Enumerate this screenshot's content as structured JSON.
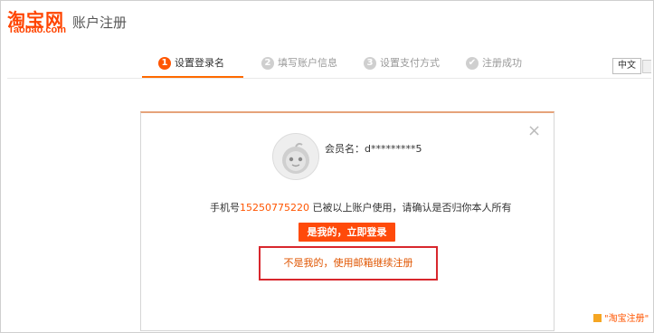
{
  "header": {
    "logo_cn": "淘宝网",
    "logo_en": "Taobao.com",
    "page_title": "账户注册"
  },
  "steps": [
    {
      "num": "1",
      "label": "设置登录名",
      "active": true
    },
    {
      "num": "2",
      "label": "填写账户信息",
      "active": false
    },
    {
      "num": "3",
      "label": "设置支付方式",
      "active": false
    },
    {
      "num": "✔",
      "label": "注册成功",
      "active": false
    }
  ],
  "lang": {
    "label": "中文"
  },
  "dialog": {
    "member_label": "会员名：",
    "member_value": "d*********5",
    "phone_prefix": "手机号",
    "phone_number": "15250775220",
    "phone_suffix": " 已被以上账户使用，请确认是否归你本人所有",
    "login_button": "是我的，立即登录",
    "email_link": "不是我的，使用邮箱继续注册",
    "close_glyph": "×"
  },
  "footer": {
    "note": "\"淘宝注册\""
  },
  "colors": {
    "accent": "#ff4a0a",
    "highlight": "#d8272d"
  }
}
